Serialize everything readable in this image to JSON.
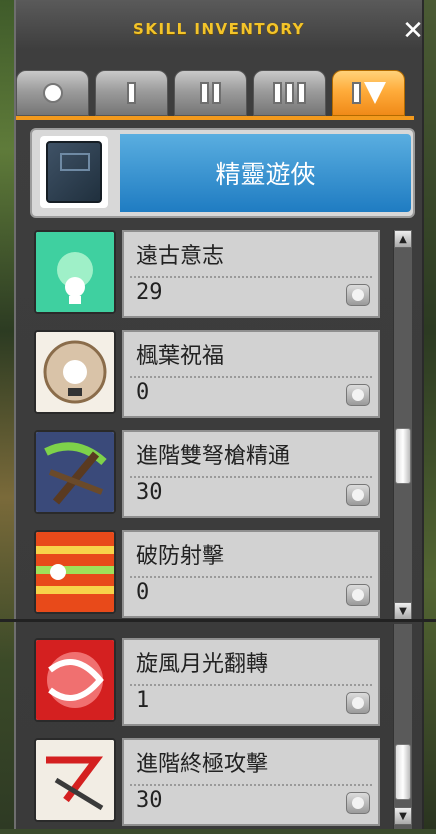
{
  "window": {
    "title": "SKILL INVENTORY"
  },
  "tabs": [
    {
      "label": "●",
      "active": false
    },
    {
      "label": "I",
      "active": false
    },
    {
      "label": "II",
      "active": false
    },
    {
      "label": "III",
      "active": false
    },
    {
      "label": "IV",
      "active": true
    }
  ],
  "job": {
    "name": "精靈遊俠",
    "icon": "book-icon"
  },
  "skills": [
    {
      "name": "遠古意志",
      "level": "29",
      "icon": "ancient-will-icon"
    },
    {
      "name": "楓葉祝福",
      "level": "0",
      "icon": "maple-blessing-icon"
    },
    {
      "name": "進階雙弩槍精通",
      "level": "30",
      "icon": "crossbow-mastery-icon"
    },
    {
      "name": "破防射擊",
      "level": "0",
      "icon": "defense-break-shot-icon"
    },
    {
      "name": "旋風月光翻轉",
      "level": "1",
      "icon": "whirlwind-moonlight-icon"
    },
    {
      "name": "進階終極攻擊",
      "level": "30",
      "icon": "advanced-final-attack-icon"
    }
  ],
  "colors": {
    "title": "#f3c42a",
    "active_tab": "#f08a18",
    "job_bar": "#1f7cc2"
  }
}
